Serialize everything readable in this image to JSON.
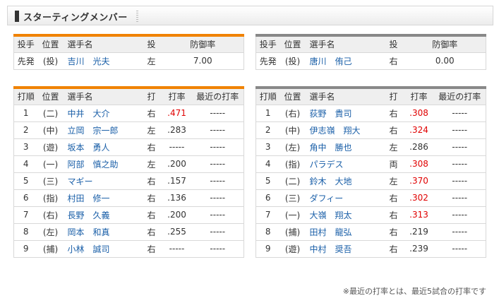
{
  "header": {
    "title": "スターティングメンバー"
  },
  "pitcher_headers": {
    "role": "投手",
    "position": "位置",
    "name": "選手名",
    "throws": "投",
    "era": "防御率"
  },
  "lineup_headers": {
    "order": "打順",
    "position": "位置",
    "name": "選手名",
    "bats": "打",
    "avg": "打率",
    "recent": "最近の打率"
  },
  "home": {
    "pitcher": {
      "role": "先発",
      "position": "(投)",
      "name": "吉川　光夫",
      "throws": "左",
      "era": "7.00"
    },
    "lineup": [
      {
        "order": "1",
        "position": "(二)",
        "name": "中井　大介",
        "bats": "右",
        "avg": ".471",
        "recent": "-----",
        "highlight": true
      },
      {
        "order": "2",
        "position": "(中)",
        "name": "立岡　宗一郎",
        "bats": "左",
        "avg": ".283",
        "recent": "-----",
        "highlight": false
      },
      {
        "order": "3",
        "position": "(遊)",
        "name": "坂本　勇人",
        "bats": "右",
        "avg": "-----",
        "recent": "-----",
        "highlight": false
      },
      {
        "order": "4",
        "position": "(一)",
        "name": "阿部　慎之助",
        "bats": "左",
        "avg": ".200",
        "recent": "-----",
        "highlight": false
      },
      {
        "order": "5",
        "position": "(三)",
        "name": "マギー",
        "bats": "右",
        "avg": ".157",
        "recent": "-----",
        "highlight": false
      },
      {
        "order": "6",
        "position": "(指)",
        "name": "村田　修一",
        "bats": "右",
        "avg": ".136",
        "recent": "-----",
        "highlight": false
      },
      {
        "order": "7",
        "position": "(右)",
        "name": "長野　久義",
        "bats": "右",
        "avg": ".200",
        "recent": "-----",
        "highlight": false
      },
      {
        "order": "8",
        "position": "(左)",
        "name": "岡本　和真",
        "bats": "右",
        "avg": ".255",
        "recent": "-----",
        "highlight": false
      },
      {
        "order": "9",
        "position": "(捕)",
        "name": "小林　誠司",
        "bats": "右",
        "avg": "-----",
        "recent": "-----",
        "highlight": false
      }
    ]
  },
  "away": {
    "pitcher": {
      "role": "先発",
      "position": "(投)",
      "name": "唐川　侑己",
      "throws": "右",
      "era": "0.00"
    },
    "lineup": [
      {
        "order": "1",
        "position": "(右)",
        "name": "荻野　貴司",
        "bats": "右",
        "avg": ".308",
        "recent": "-----",
        "highlight": true
      },
      {
        "order": "2",
        "position": "(中)",
        "name": "伊志嶺　翔大",
        "bats": "右",
        "avg": ".324",
        "recent": "-----",
        "highlight": true
      },
      {
        "order": "3",
        "position": "(左)",
        "name": "角中　勝也",
        "bats": "左",
        "avg": ".286",
        "recent": "-----",
        "highlight": false
      },
      {
        "order": "4",
        "position": "(指)",
        "name": "パラデス",
        "bats": "両",
        "avg": ".308",
        "recent": "-----",
        "highlight": true
      },
      {
        "order": "5",
        "position": "(二)",
        "name": "鈴木　大地",
        "bats": "左",
        "avg": ".370",
        "recent": "-----",
        "highlight": true
      },
      {
        "order": "6",
        "position": "(三)",
        "name": "ダフィー",
        "bats": "右",
        "avg": ".302",
        "recent": "-----",
        "highlight": true
      },
      {
        "order": "7",
        "position": "(一)",
        "name": "大嶺　翔太",
        "bats": "右",
        "avg": ".313",
        "recent": "-----",
        "highlight": true
      },
      {
        "order": "8",
        "position": "(捕)",
        "name": "田村　龍弘",
        "bats": "右",
        "avg": ".219",
        "recent": "-----",
        "highlight": false
      },
      {
        "order": "9",
        "position": "(遊)",
        "name": "中村　奨吾",
        "bats": "右",
        "avg": ".239",
        "recent": "-----",
        "highlight": false
      }
    ]
  },
  "footnote": "※最近の打率とは、最近5試合の打率です",
  "colors": {
    "home_accent": "#f08200",
    "away_accent": "#888888",
    "link": "#1a5fa8",
    "highlight": "#e00000"
  }
}
